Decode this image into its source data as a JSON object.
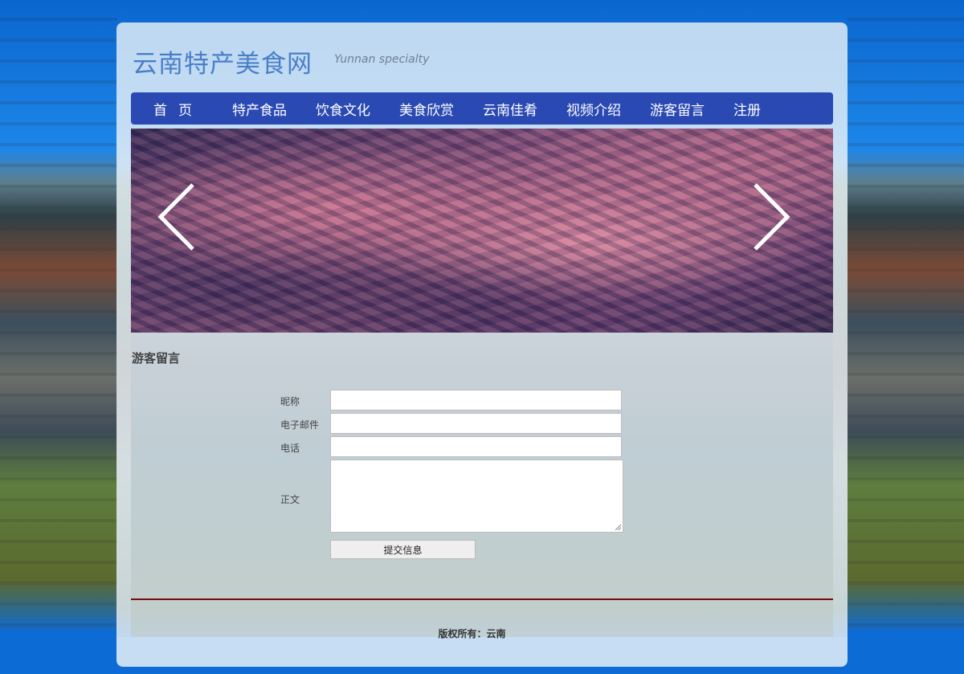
{
  "header": {
    "title": "云南特产美食网",
    "subtitle": "Yunnan specialty"
  },
  "nav": {
    "items": [
      {
        "label": "首页"
      },
      {
        "label": "特产食品"
      },
      {
        "label": "饮食文化"
      },
      {
        "label": "美食欣赏"
      },
      {
        "label": "云南佳肴"
      },
      {
        "label": "视频介绍"
      },
      {
        "label": "游客留言"
      },
      {
        "label": "注册"
      }
    ]
  },
  "banner": {
    "prev_icon": "chevron-left-icon",
    "next_icon": "chevron-right-icon"
  },
  "guestbook": {
    "title": "游客留言",
    "fields": {
      "nickname_label": "昵称",
      "email_label": "电子邮件",
      "phone_label": "电话",
      "body_label": "正文"
    },
    "submit_label": "提交信息"
  },
  "footer": {
    "copyright": "版权所有：云南"
  },
  "colors": {
    "nav_bg": "#2a49b3",
    "title": "#4a7fc8",
    "divider": "#7a0b0b"
  }
}
